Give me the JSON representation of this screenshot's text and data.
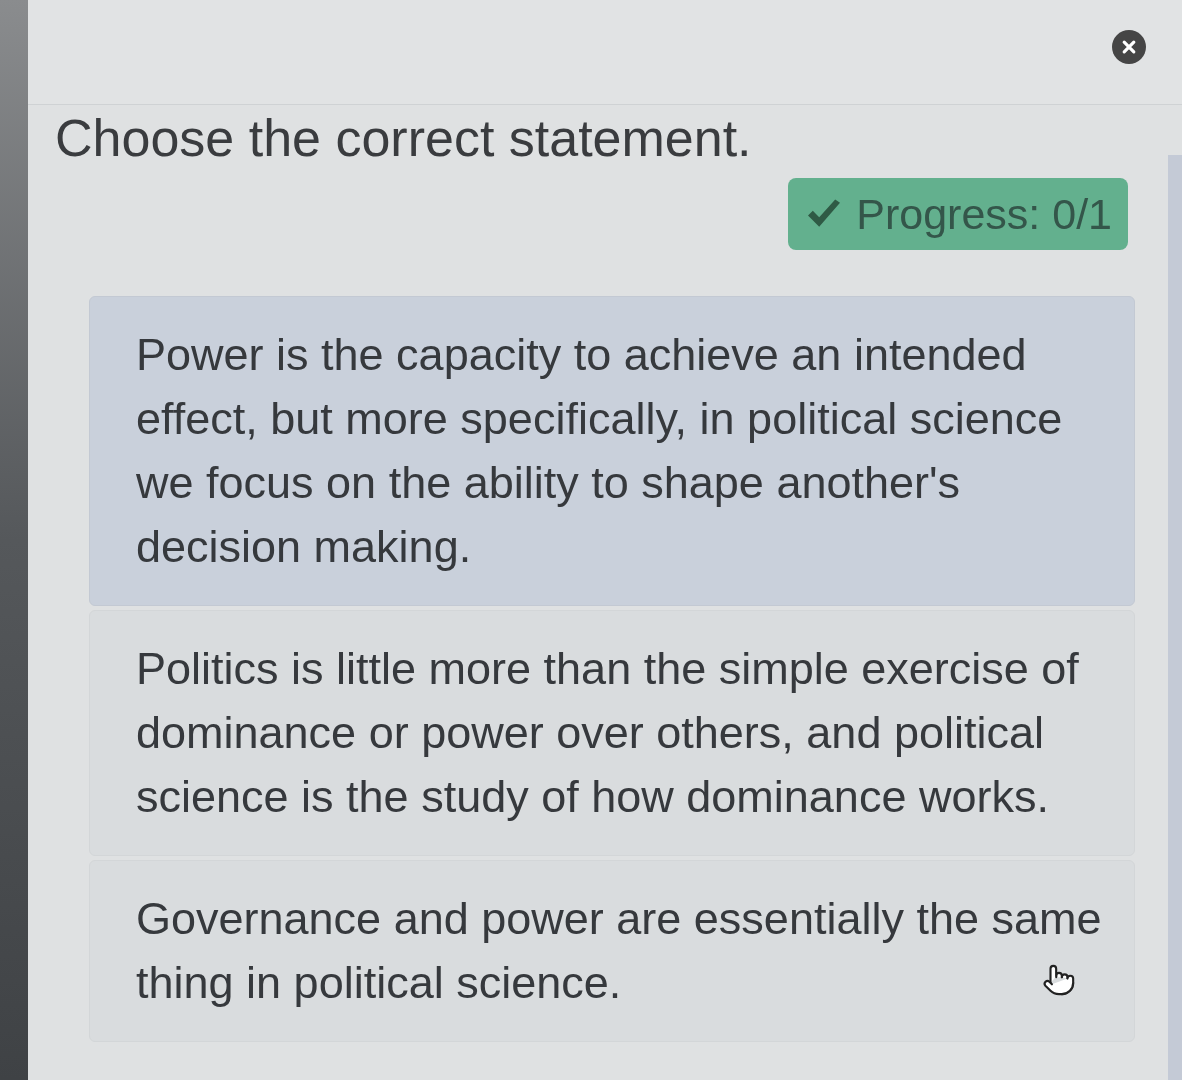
{
  "question": {
    "prompt": "Choose the correct statement."
  },
  "progress": {
    "label": "Progress: 0/1"
  },
  "options": [
    {
      "text": "Power is the capacity to achieve an intended effect, but more specifically, in political science we focus on the ability to shape another's decision making.",
      "selected": true
    },
    {
      "text": "Politics is little more than the simple exercise of dominance or power over others, and political science is the study of how dominance works.",
      "selected": false
    },
    {
      "text": "Governance and power are essentially the same thing in political science.",
      "selected": false
    }
  ]
}
